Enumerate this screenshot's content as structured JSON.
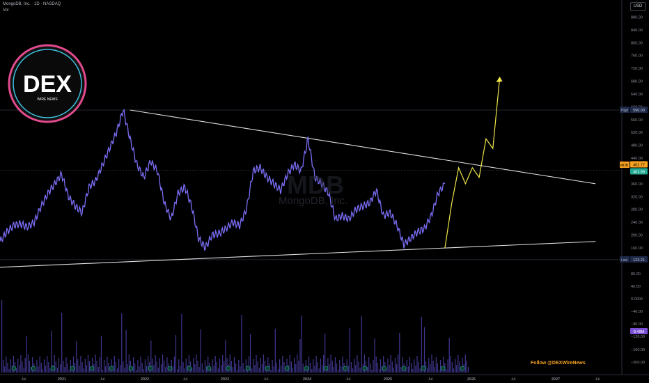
{
  "header": {
    "title": "MongoDB, Inc. · 1D · NASDAQ",
    "vol_label": "Vol"
  },
  "currency": "USD",
  "watermark": {
    "symbol": "MDB",
    "name": "MongoDB, Inc."
  },
  "logo": {
    "text": "DEX",
    "subtext": "WIRE NEWS"
  },
  "footer": {
    "follow": "Follow @DEXWireNews"
  },
  "colors": {
    "price_line": "#7b6ef6",
    "trendline": "#e0e0e0",
    "projection": "#f0e84a",
    "volume": "#5b4fcf",
    "background": "#000000"
  },
  "chart_data": {
    "type": "line",
    "title": "MongoDB, Inc. · 1D · NASDAQ",
    "price_axis": {
      "ticks": [
        "880.00",
        "840.00",
        "800.00",
        "760.00",
        "720.00",
        "680.00",
        "640.00",
        "600.00",
        "560.00",
        "520.00",
        "480.00",
        "440.00",
        "400.00",
        "360.00",
        "320.00",
        "280.00",
        "240.00",
        "200.00",
        "160.00"
      ],
      "ylim": [
        123,
        900
      ]
    },
    "volume_axis": {
      "ticks": [
        "80.00",
        "40.00",
        "0.0000",
        "−40.00",
        "−80.00",
        "−120.00",
        "−160.00",
        "−200.00"
      ]
    },
    "time_axis": {
      "ticks": [
        "Jul",
        "2021",
        "Jul",
        "2022",
        "Jul",
        "2023",
        "Jul",
        "2024",
        "Jul",
        "2025",
        "Jul",
        "2026",
        "Jul",
        "2027",
        "Jul"
      ]
    },
    "labels": {
      "high": {
        "text": "High",
        "value": "590.00"
      },
      "low": {
        "text": "Low",
        "value": "123.21"
      },
      "current": {
        "text": "MDB",
        "value": "402.77"
      },
      "prev": {
        "value": "401.99"
      },
      "volume": {
        "value": "8.49M"
      }
    },
    "series": [
      {
        "x": [
          "2020-05",
          "2020-06",
          "2020-07",
          "2020-08",
          "2020-09",
          "2020-10",
          "2020-11",
          "2020-12",
          "2021-01",
          "2021-02",
          "2021-03",
          "2021-04",
          "2021-05",
          "2021-06",
          "2021-07",
          "2021-08",
          "2021-09",
          "2021-10",
          "2021-11",
          "2021-12",
          "2022-01",
          "2022-02",
          "2022-03",
          "2022-04",
          "2022-05",
          "2022-06",
          "2022-07",
          "2022-08",
          "2022-09",
          "2022-10",
          "2022-11",
          "2022-12",
          "2023-01",
          "2023-02",
          "2023-03",
          "2023-04",
          "2023-05",
          "2023-06",
          "2023-07",
          "2023-08",
          "2023-09",
          "2023-10",
          "2023-11",
          "2023-12",
          "2024-01",
          "2024-02",
          "2024-03",
          "2024-04",
          "2024-05",
          "2024-06",
          "2024-07",
          "2024-08",
          "2024-09",
          "2024-10",
          "2024-11",
          "2024-12",
          "2025-01",
          "2025-02",
          "2025-03",
          "2025-04",
          "2025-05",
          "2025-06",
          "2025-07",
          "2025-08",
          "2025-09",
          "2025-10"
        ],
        "values": [
          180,
          210,
          230,
          235,
          225,
          240,
          290,
          330,
          360,
          390,
          320,
          290,
          270,
          350,
          370,
          420,
          470,
          520,
          590,
          500,
          420,
          380,
          430,
          400,
          300,
          250,
          330,
          350,
          290,
          190,
          160,
          200,
          205,
          220,
          240,
          230,
          280,
          400,
          410,
          380,
          360,
          340,
          390,
          420,
          400,
          500,
          380,
          360,
          330,
          250,
          260,
          250,
          280,
          290,
          300,
          340,
          260,
          270,
          230,
          170,
          190,
          210,
          220,
          260,
          330,
          360
        ]
      },
      {
        "name": "projection",
        "x": [
          "2025-10",
          "2025-11",
          "2025-12",
          "2026-01",
          "2026-02",
          "2026-03",
          "2026-04",
          "2026-05",
          "2026-06"
        ],
        "values": [
          160,
          300,
          410,
          360,
          410,
          380,
          500,
          470,
          690
        ]
      }
    ],
    "trendlines": [
      {
        "x": [
          "2021-12",
          "2027-08"
        ],
        "values": [
          590,
          360
        ]
      },
      {
        "x": [
          "2019-12",
          "2027-08"
        ],
        "values": [
          95,
          180
        ]
      }
    ]
  }
}
